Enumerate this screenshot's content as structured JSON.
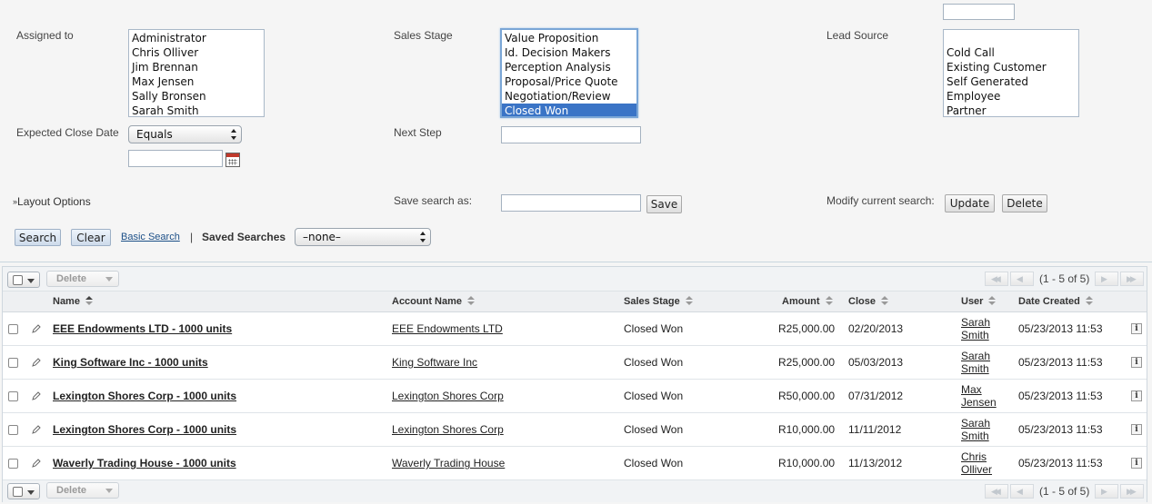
{
  "search": {
    "assigned_to": {
      "label": "Assigned to",
      "options": [
        "Administrator",
        "Chris Olliver",
        "Jim Brennan",
        "Max Jensen",
        "Sally Bronsen",
        "Sarah Smith"
      ]
    },
    "sales_stage": {
      "label": "Sales Stage",
      "options": [
        "Value Proposition",
        "Id. Decision Makers",
        "Perception Analysis",
        "Proposal/Price Quote",
        "Negotiation/Review",
        "Closed Won"
      ],
      "selected": "Closed Won"
    },
    "lead_source": {
      "label": "Lead Source",
      "options": [
        "",
        "Cold Call",
        "Existing Customer",
        "Self Generated",
        "Employee",
        "Partner"
      ]
    },
    "expected_close_date": {
      "label": "Expected Close Date",
      "operator": "Equals",
      "value": ""
    },
    "next_step": {
      "label": "Next Step",
      "value": ""
    },
    "layout_options": "Layout Options",
    "save_search_as": {
      "label": "Save search as:",
      "value": "",
      "button": "Save"
    },
    "modify_current_search": {
      "label": "Modify current search:",
      "update": "Update",
      "delete": "Delete"
    },
    "search_button": "Search",
    "clear_button": "Clear",
    "basic_search_link": "Basic Search",
    "separator": "|",
    "saved_searches": {
      "label": "Saved Searches",
      "value": "–none–"
    }
  },
  "list": {
    "delete_label": "Delete",
    "page_count": "(1 - 5 of 5)",
    "columns": {
      "name": "Name",
      "account_name": "Account Name",
      "sales_stage": "Sales Stage",
      "amount": "Amount",
      "close": "Close",
      "user": "User",
      "date_created": "Date Created"
    },
    "rows": [
      {
        "name": "EEE Endowments LTD - 1000 units",
        "account": "EEE Endowments LTD",
        "stage": "Closed Won",
        "amount": "R25,000.00",
        "close": "02/20/2013",
        "user_first": "Sarah",
        "user_last": "Smith",
        "created": "05/23/2013 11:53"
      },
      {
        "name": "King Software Inc - 1000 units",
        "account": "King Software Inc",
        "stage": "Closed Won",
        "amount": "R25,000.00",
        "close": "05/03/2013",
        "user_first": "Sarah",
        "user_last": "Smith",
        "created": "05/23/2013 11:53"
      },
      {
        "name": "Lexington Shores Corp - 1000 units",
        "account": "Lexington Shores Corp",
        "stage": "Closed Won",
        "amount": "R50,000.00",
        "close": "07/31/2012",
        "user_first": "Max",
        "user_last": "Jensen",
        "created": "05/23/2013 11:53"
      },
      {
        "name": "Lexington Shores Corp - 1000 units",
        "account": "Lexington Shores Corp",
        "stage": "Closed Won",
        "amount": "R10,000.00",
        "close": "11/11/2012",
        "user_first": "Sarah",
        "user_last": "Smith",
        "created": "05/23/2013 11:53"
      },
      {
        "name": "Waverly Trading House - 1000 units",
        "account": "Waverly Trading House",
        "stage": "Closed Won",
        "amount": "R10,000.00",
        "close": "11/13/2012",
        "user_first": "Chris",
        "user_last": "Olliver",
        "created": "05/23/2013 11:53"
      }
    ],
    "info_glyph": "i",
    "edit_icon": "pencil-icon"
  }
}
